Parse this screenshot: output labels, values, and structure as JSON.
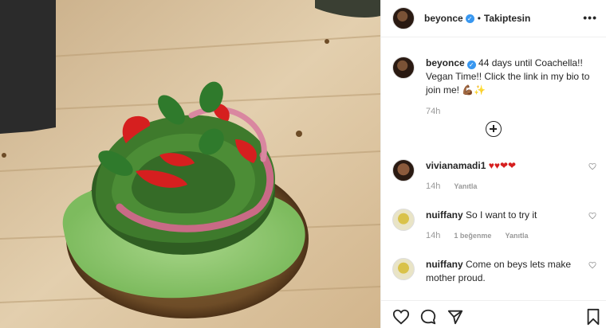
{
  "header": {
    "username": "beyonce",
    "verified_badge": "✓",
    "dot": "•",
    "follow_label": "Takiptesin",
    "more_label": "•••"
  },
  "caption": {
    "username": "beyonce",
    "text": "44 days until Coachella!! Vegan Time!! Click the link in my bio to join me! 💪🏾✨",
    "time": "74h"
  },
  "comments": [
    {
      "username": "vivianamadi1",
      "text": "♥♥❤❤",
      "time": "14h",
      "likes": "",
      "reply_label": "Yanıtla"
    },
    {
      "username": "nuiffany",
      "text": "So I want to try it",
      "time": "14h",
      "likes": "1 beğenme",
      "reply_label": "Yanıtla"
    },
    {
      "username": "nuiffany",
      "text": "Come on beys lets make mother proud.",
      "time": "",
      "likes": "",
      "reply_label": ""
    }
  ],
  "actions": {
    "like_icon": "heart-icon",
    "comment_icon": "comment-icon",
    "share_icon": "share-icon",
    "save_icon": "bookmark-icon"
  },
  "colors": {
    "verified": "#3897f0",
    "meta_text": "#999999",
    "divider": "#efefef"
  }
}
